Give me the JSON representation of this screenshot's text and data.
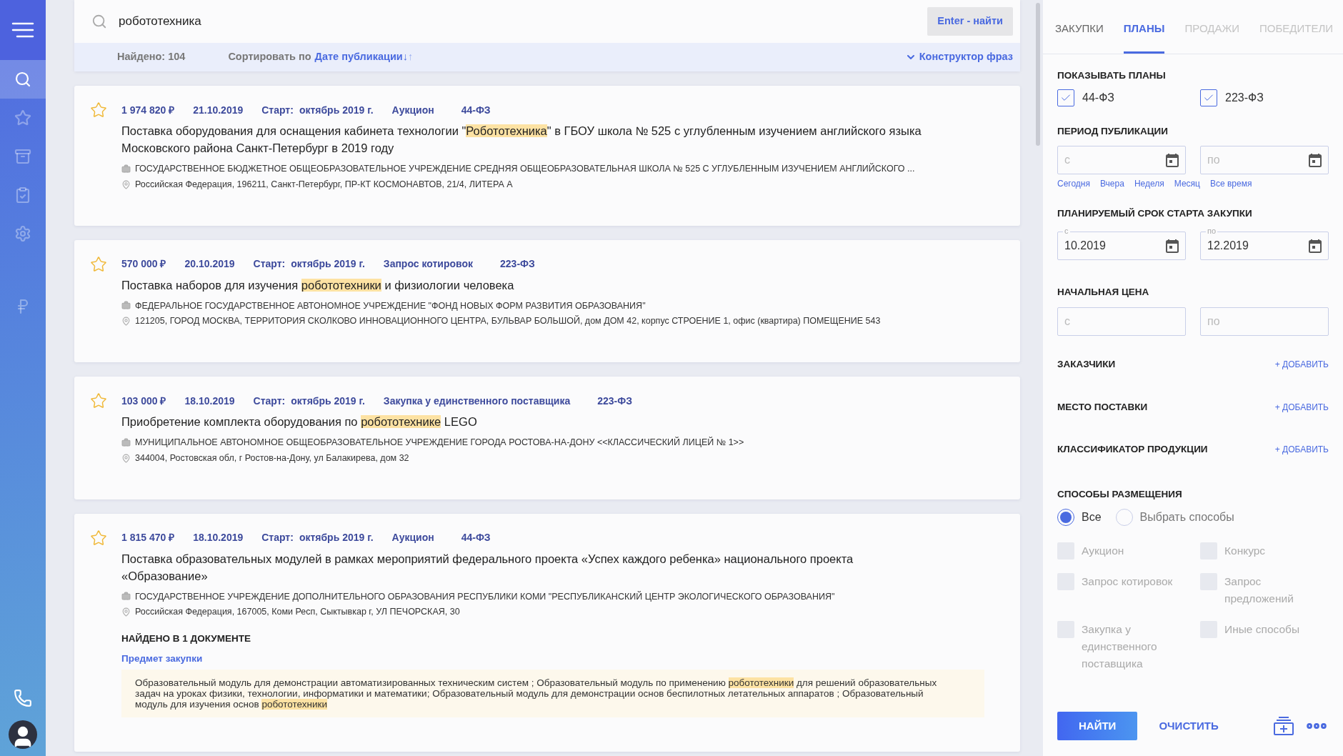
{
  "sidebar": {
    "items": [
      {
        "selected": true
      },
      {
        "selected": false
      },
      {
        "selected": false
      },
      {
        "selected": false
      },
      {
        "selected": false
      },
      {
        "selected": false
      }
    ]
  },
  "search": {
    "value": "робототехника",
    "button": "Enter - найти"
  },
  "results_bar": {
    "found": "Найдено: 104",
    "sort_label": "Сортировать по",
    "sort_value": "Дате публикации↓",
    "sort_alt": "↑",
    "phrase_builder": "Конструктор фраз"
  },
  "results": [
    {
      "starred": false,
      "price": "1 974 820 ₽",
      "date": "21.10.2019",
      "start_label": "Старт:",
      "start": "октябрь 2019 г.",
      "method": "Аукцион",
      "law": "44-ФЗ",
      "title": [
        {
          "text": "Поставка оборудования для оснащения кабинета технологии \"",
          "highlight": false
        },
        {
          "text": "Робототехника",
          "highlight": true
        },
        {
          "text": "\" в ГБОУ школа № 525 с углубленным изучением английского языка Московского района Санкт-Петербург в 2019 году",
          "highlight": false
        }
      ],
      "customer": "ГОСУДАРСТВЕННОЕ БЮДЖЕТНОЕ ОБЩЕОБРАЗОВАТЕЛЬНОЕ УЧРЕЖДЕНИЕ СРЕДНЯЯ ОБЩЕОБРАЗОВАТЕЛЬНАЯ ШКОЛА № 525 С УГЛУБЛЕННЫМ ИЗУЧЕНИЕМ АНГЛИЙСКОГО ...",
      "address": "Российская Федерация, 196211, Санкт-Петербург, ПР-КТ КОСМОНАВТОВ, 21/4, ЛИТЕРА А"
    },
    {
      "starred": false,
      "price": "570 000 ₽",
      "date": "20.10.2019",
      "start_label": "Старт:",
      "start": "октябрь 2019 г.",
      "method": "Запрос котировок",
      "law": "223-ФЗ",
      "title": [
        {
          "text": "Поставка наборов для изучения ",
          "highlight": false
        },
        {
          "text": "робототехники",
          "highlight": true
        },
        {
          "text": " и физиологии человека",
          "highlight": false
        }
      ],
      "customer": "ФЕДЕРАЛЬНОЕ ГОСУДАРСТВЕННОЕ АВТОНОМНОЕ УЧРЕЖДЕНИЕ \"ФОНД НОВЫХ ФОРМ РАЗВИТИЯ ОБРАЗОВАНИЯ\"",
      "address": "121205, ГОРОД МОСКВА, ТЕРРИТОРИЯ СКОЛКОВО ИННОВАЦИОННОГО ЦЕНТРА, БУЛЬВАР БОЛЬШОЙ, дом ДОМ 42, корпус СТРОЕНИЕ 1, офис (квартира) ПОМЕЩЕНИЕ 543"
    },
    {
      "starred": false,
      "price": "103 000 ₽",
      "date": "18.10.2019",
      "start_label": "Старт:",
      "start": "октябрь 2019 г.",
      "method": "Закупка у единственного поставщика",
      "law": "223-ФЗ",
      "title": [
        {
          "text": "Приобретение комплекта оборудования по ",
          "highlight": false
        },
        {
          "text": "робототехнике",
          "highlight": true
        },
        {
          "text": " LEGO",
          "highlight": false
        }
      ],
      "customer": "МУНИЦИПАЛЬНОЕ АВТОНОМНОЕ ОБЩЕОБРАЗОВАТЕЛЬНОЕ УЧРЕЖДЕНИЕ ГОРОДА РОСТОВА-НА-ДОНУ <<КЛАССИЧЕСКИЙ ЛИЦЕЙ № 1>>",
      "address": "344004, Ростовская обл, г Ростов-на-Дону, ул Балакирева, дом 32"
    },
    {
      "starred": false,
      "price": "1 815 470 ₽",
      "date": "18.10.2019",
      "start_label": "Старт:",
      "start": "октябрь 2019 г.",
      "method": "Аукцион",
      "law": "44-ФЗ",
      "title": [
        {
          "text": "Поставка образовательных модулей в рамках мероприятий федерального проекта «Успех каждого ребенка» национального проекта «Образование»",
          "highlight": false
        }
      ],
      "customer": "ГОСУДАРСТВЕННОЕ УЧРЕЖДЕНИЕ ДОПОЛНИТЕЛЬНОГО ОБРАЗОВАНИЯ РЕСПУБЛИКИ КОМИ \"РЕСПУБЛИКАНСКИЙ ЦЕНТР ЭКОЛОГИЧЕСКОГО ОБРАЗОВАНИЯ\"",
      "address": "Российская Федерация, 167005, Коми Респ, Сыктывкар г, УЛ ПЕЧОРСКАЯ, 30",
      "found_in": {
        "heading": "НАЙДЕНО В 1 ДОКУМЕНТЕ",
        "link": "Предмет закупки",
        "excerpt": [
          {
            "text": "Образовательный модуль для демонстрации автоматизированных техническим систем ; Образовательный модуль по применению ",
            "highlight": false
          },
          {
            "text": "робототехники",
            "highlight": true
          },
          {
            "text": " для решений образовательных задач на уроках физики, технологии, информатики и математики; Образовательный модуль для демонстрации основ беспилотных летательных аппаратов ; Образовательный модуль для изучения основ ",
            "highlight": false
          },
          {
            "text": "робототехники",
            "highlight": true
          }
        ]
      }
    }
  ],
  "panel": {
    "tabs": [
      {
        "label": "ЗАКУПКИ",
        "selected": false,
        "disabled": false
      },
      {
        "label": "ПЛАНЫ",
        "selected": true,
        "disabled": false
      },
      {
        "label": "ПРОДАЖИ",
        "selected": false,
        "disabled": true
      },
      {
        "label": "ПОБЕДИТЕЛИ",
        "selected": false,
        "disabled": true
      }
    ],
    "show_plans": {
      "heading": "ПОКАЗЫВАТЬ ПЛАНЫ",
      "options": [
        {
          "label": "44-ФЗ",
          "checked": true
        },
        {
          "label": "223-ФЗ",
          "checked": true
        }
      ]
    },
    "publication_period": {
      "heading": "ПЕРИОД ПУБЛИКАЦИИ",
      "from": {
        "placeholder": "с"
      },
      "to": {
        "placeholder": "по"
      },
      "quick": [
        "Сегодня",
        "Вчера",
        "Неделя",
        "Месяц",
        "Все время"
      ]
    },
    "start_period": {
      "heading": "ПЛАНИРУЕМЫЙ СРОК СТАРТА ЗАКУПКИ",
      "from": {
        "label": "с",
        "value": "10.2019"
      },
      "to": {
        "label": "по",
        "value": "12.2019"
      }
    },
    "price": {
      "heading": "НАЧАЛЬНАЯ ЦЕНА",
      "from": {
        "placeholder": "с"
      },
      "to": {
        "placeholder": "по"
      }
    },
    "add_sections": [
      {
        "heading": "ЗАКАЗЧИКИ",
        "action": "+ ДОБАВИТЬ"
      },
      {
        "heading": "МЕСТО ПОСТАВКИ",
        "action": "+ ДОБАВИТЬ"
      },
      {
        "heading": "КЛАССИФИКАТОР ПРОДУКЦИИ",
        "action": "+ ДОБАВИТЬ"
      }
    ],
    "placement": {
      "heading": "СПОСОБЫ РАЗМЕЩЕНИЯ",
      "radios": [
        {
          "label": "Все",
          "selected": true
        },
        {
          "label": "Выбрать способы",
          "selected": false
        }
      ],
      "methods": [
        {
          "label": "Аукцион",
          "checked": false,
          "disabled": true
        },
        {
          "label": "Конкурс",
          "checked": false,
          "disabled": true
        },
        {
          "label": "Запрос котировок",
          "checked": false,
          "disabled": true
        },
        {
          "label": "Запрос предложений",
          "checked": false,
          "disabled": true
        },
        {
          "label": "Закупка у единственного поставщика",
          "checked": false,
          "disabled": true
        },
        {
          "label": "Иные способы",
          "checked": false,
          "disabled": true
        }
      ]
    },
    "actions": {
      "find": "НАЙТИ",
      "clear": "ОЧИСТИТЬ"
    }
  }
}
